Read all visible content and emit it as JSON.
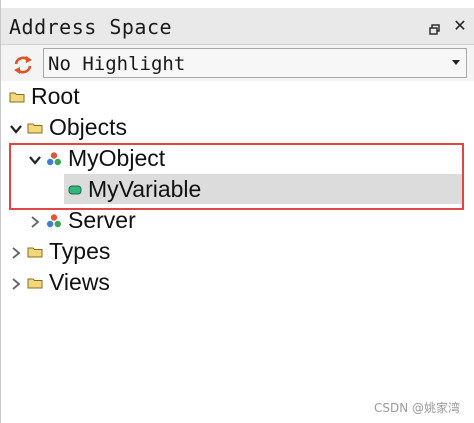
{
  "panel": {
    "title": "Address Space",
    "pin_icon": "pin-icon",
    "close_icon": "close-icon"
  },
  "toolbar": {
    "refresh_icon": "refresh-icon",
    "highlight_select": {
      "value": "No Highlight"
    }
  },
  "tree": {
    "root": {
      "label": "Root",
      "icon": "folder-icon"
    },
    "objects": {
      "label": "Objects",
      "icon": "folder-icon",
      "expanded": true
    },
    "my_object": {
      "label": "MyObject",
      "icon": "object-icon",
      "expanded": true
    },
    "my_variable": {
      "label": "MyVariable",
      "icon": "variable-icon",
      "selected": true
    },
    "server": {
      "label": "Server",
      "icon": "object-icon",
      "expanded": false
    },
    "types": {
      "label": "Types",
      "icon": "folder-icon",
      "expanded": false
    },
    "views": {
      "label": "Views",
      "icon": "folder-icon",
      "expanded": false
    }
  },
  "watermark": "CSDN @姚家湾",
  "colors": {
    "highlight_box": "#e04646",
    "selection": "#dcdcdc",
    "folder": "#e8c86a",
    "variable": "#2fa36b"
  }
}
